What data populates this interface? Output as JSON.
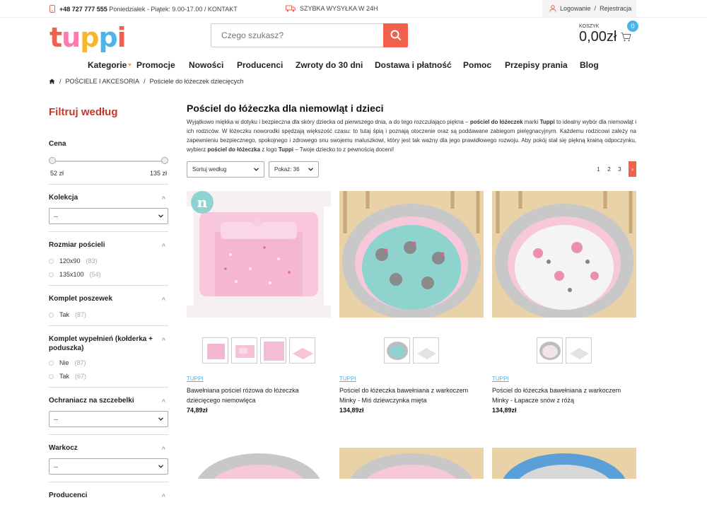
{
  "topbar": {
    "phone": "+48 727 777 555",
    "hours": "Poniedziałek - Piątek: 9.00-17.00 / KONTAKT",
    "shipping": "SZYBKA WYSYŁKA W 24H",
    "login": "Logowanie",
    "sep": "/",
    "register": "Rejestracja"
  },
  "logo": {
    "t": "t",
    "u": "u",
    "p1": "p",
    "p2": "p",
    "i": "i"
  },
  "search": {
    "placeholder": "Czego szukasz?"
  },
  "cart": {
    "label": "KOSZYK",
    "total": "0,00zł",
    "count": "0"
  },
  "nav": {
    "items": [
      "Kategorie",
      "Promocje",
      "Nowości",
      "Producenci",
      "Zwroty do 30 dni",
      "Dostawa i płatność",
      "Pomoc",
      "Przepisy prania",
      "Blog"
    ]
  },
  "breadcrumb": {
    "sep1": "/",
    "cat": "POŚCIELE I AKCESORIA",
    "sep2": "/",
    "current": "Pościele do łóżeczek dziecięcych"
  },
  "sidebar": {
    "title": "Filtruj według",
    "price": {
      "label": "Cena",
      "min": "52 zł",
      "max": "135 zł"
    },
    "kolekcja": {
      "label": "Kolekcja",
      "value": "--"
    },
    "rozmiar": {
      "label": "Rozmiar pościeli",
      "options": [
        {
          "label": "120x90",
          "count": "(83)"
        },
        {
          "label": "135x100",
          "count": "(54)"
        }
      ]
    },
    "poszewek": {
      "label": "Komplet poszewek",
      "options": [
        {
          "label": "Tak",
          "count": "(87)"
        }
      ]
    },
    "wypelnien": {
      "label": "Komplet wypełnień (kołderka + poduszka)",
      "options": [
        {
          "label": "Nie",
          "count": "(87)"
        },
        {
          "label": "Tak",
          "count": "(67)"
        }
      ]
    },
    "ochraniacz": {
      "label": "Ochraniacz na szczebelki",
      "value": "--"
    },
    "warkocz": {
      "label": "Warkocz",
      "value": "--"
    },
    "producenci": {
      "label": "Producenci"
    }
  },
  "main": {
    "title": "Pościel do łóżeczka dla niemowląt i dzieci",
    "desc1": "Wyjątkowo miękka w dotyku i bezpieczna dla skóry dziecka od pierwszego dnia, a do tego rozczulająco piękna – ",
    "desc_b1": "pościel do łóżeczek",
    "desc2": " marki ",
    "desc_b2": "Tuppi",
    "desc3": " to idealny wybór dla niemowląt i ich rodziców. W łóżeczku noworodki spędzają większość czasu: to tutaj śpią i poznają otoczenie oraz są poddawane zabiegom pielęgnacyjnym. Każdemu rodzicowi zależy na zapewnieniu bezpiecznego, spokojnego i zdrowego snu swojemu maluszkowi, który jest tak ważny dla jego prawidłowego rozwoju. Aby pokój stał się piękną krainą odpoczynku, wybierz ",
    "desc_b3": "pościel do łóżeczka",
    "desc4": " z logo ",
    "desc_b4": "Tuppi",
    "desc5": " – Twoje dziecko to z pewnością doceni!",
    "sort": "Sortuj według",
    "perpage": "Pokaż: 36",
    "pages": [
      "1",
      "2",
      "3"
    ],
    "next": "›"
  },
  "products": [
    {
      "brand": "TUPPI",
      "name": "Bawełniana pościel różowa do łóżeczka dziecięcego niemowlęca",
      "price": "74,89zł",
      "badge": "n"
    },
    {
      "brand": "TUPPI",
      "name": "Pościel do łóżeczka bawełniana z warkoczem Minky - Miś dziewczynka mięta",
      "price": "134,89zł"
    },
    {
      "brand": "TUPPI",
      "name": "Pościel do łóżeczka bawełniana z warkoczem Minky - Łapacze snów z różą",
      "price": "134,89zł"
    }
  ],
  "colors": {
    "accent": "#f0604b",
    "title_red": "#c0392b",
    "link_blue": "#4cb5e8"
  }
}
